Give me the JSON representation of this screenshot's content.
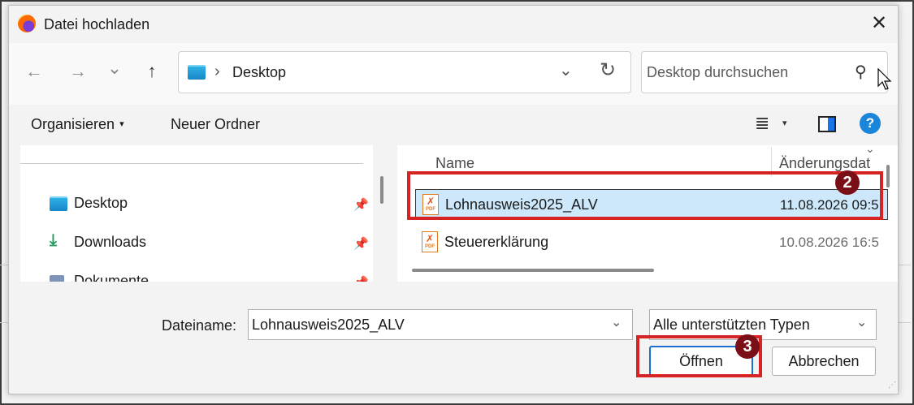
{
  "dialog": {
    "title": "Datei hochladen",
    "close_glyph": "✕"
  },
  "nav": {
    "back_glyph": "←",
    "forward_glyph": "→",
    "recent_glyph": "⌄",
    "up_glyph": "↑"
  },
  "address": {
    "separator": "›",
    "path": "Desktop",
    "dropdown_glyph": "⌄",
    "refresh_glyph": "↻"
  },
  "search": {
    "placeholder": "Desktop durchsuchen",
    "icon_glyph": "⚲"
  },
  "toolbar": {
    "organize_label": "Organisieren",
    "organize_caret": "▾",
    "new_folder_label": "Neuer Ordner",
    "view_glyph": "≣",
    "view_caret": "▾",
    "help_glyph": "?"
  },
  "sidebar": {
    "items": [
      {
        "label": "Desktop",
        "icon": "desktop-folder-icon"
      },
      {
        "label": "Downloads",
        "icon": "download-arrow-icon"
      },
      {
        "label": "Dokumente",
        "icon": "documents-icon"
      }
    ],
    "pin_glyph": "📌"
  },
  "file_list": {
    "columns": {
      "name": "Name",
      "date": "Änderungsdat"
    },
    "sort_glyph": "⌄",
    "rows": [
      {
        "name": "Lohnausweis2025_ALV",
        "date": "11.08.2026 09:5",
        "selected": true
      },
      {
        "name": "Steuererklärung",
        "date": "10.08.2026 16:5",
        "selected": false
      }
    ],
    "pdf_text": "PDF"
  },
  "annotations": {
    "step2": "2",
    "step3": "3",
    "highlight_color": "#d62424",
    "badge_color": "#7a0f17"
  },
  "bottom": {
    "filename_label": "Dateiname:",
    "filename_value": "Lohnausweis2025_ALV",
    "filetype_value": "Alle unterstützten Typen",
    "chevron_glyph": "⌄",
    "open_label": "Öffnen",
    "cancel_label": "Abbrechen"
  },
  "colors": {
    "accent": "#1a6fd0",
    "selection": "#cde8fb"
  }
}
